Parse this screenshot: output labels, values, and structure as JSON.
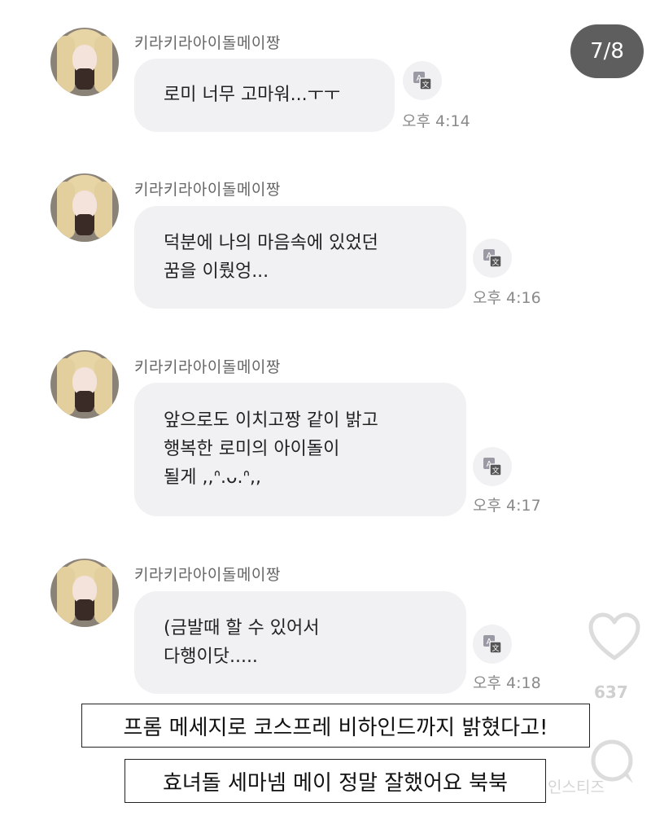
{
  "page_counter": "7/8",
  "sender_name": "키라키라아이돌메이짱",
  "messages": [
    {
      "lines": [
        "로미 너무 고마워...ㅜㅜ"
      ],
      "time": "오후 4:14"
    },
    {
      "lines": [
        "덕분에 나의 마음속에 있었던",
        "꿈을 이뤘엉..."
      ],
      "time": "오후 4:16"
    },
    {
      "lines": [
        "앞으로도 이치고짱 같이 밝고",
        "행복한 로미의 아이돌이",
        "될게 ,,ᐢ.ᴗ.ᐢ,,"
      ],
      "time": "오후 4:17"
    },
    {
      "lines": [
        "(금발때 할 수 있어서",
        "다행이닷....."
      ],
      "time": "오후 4:18"
    }
  ],
  "captions": {
    "line1": "프롬 메세지로 코스프레 비하인드까지 밝혔다고!",
    "line2": "효녀돌 세마넴 메이 정말 잘했어요 북북"
  },
  "side": {
    "like_count": "637",
    "watermark": "인스티즈"
  },
  "icons": {
    "translate": "translate-icon",
    "heart": "heart-icon",
    "comment": "comment-icon"
  },
  "colors": {
    "bubble": "#f1f1f4",
    "counter_bg": "#5e5e5e",
    "time": "#8a8a8a"
  }
}
